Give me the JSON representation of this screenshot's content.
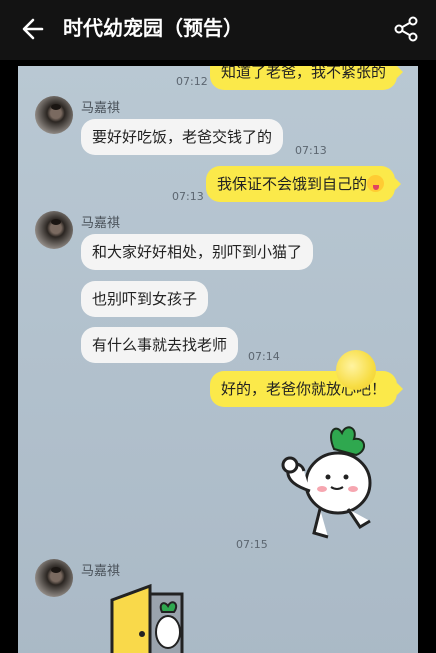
{
  "header": {
    "title": "时代幼宠园（预告）",
    "back_icon": "arrow-left-icon",
    "share_icon": "share-icon"
  },
  "messages": {
    "top_partial": "知道了老爸，我不紧张的",
    "t1": "07:12",
    "sender": "马嘉祺",
    "m1": "要好好吃饭，老爸交钱了的",
    "t2": "07:13",
    "t3": "07:13",
    "r1": "我保证不会饿到自己的",
    "m2": "和大家好好相处，别吓到小猫了",
    "m3": "也别吓到女孩子",
    "m4": "有什么事就去找老师",
    "t4": "07:14",
    "r2": "好的，老爸你就放心吧！",
    "t5": "07:15"
  },
  "colors": {
    "my_bubble": "#fbe94a",
    "their_bubble": "#f4f4f4",
    "header": "#131313"
  }
}
